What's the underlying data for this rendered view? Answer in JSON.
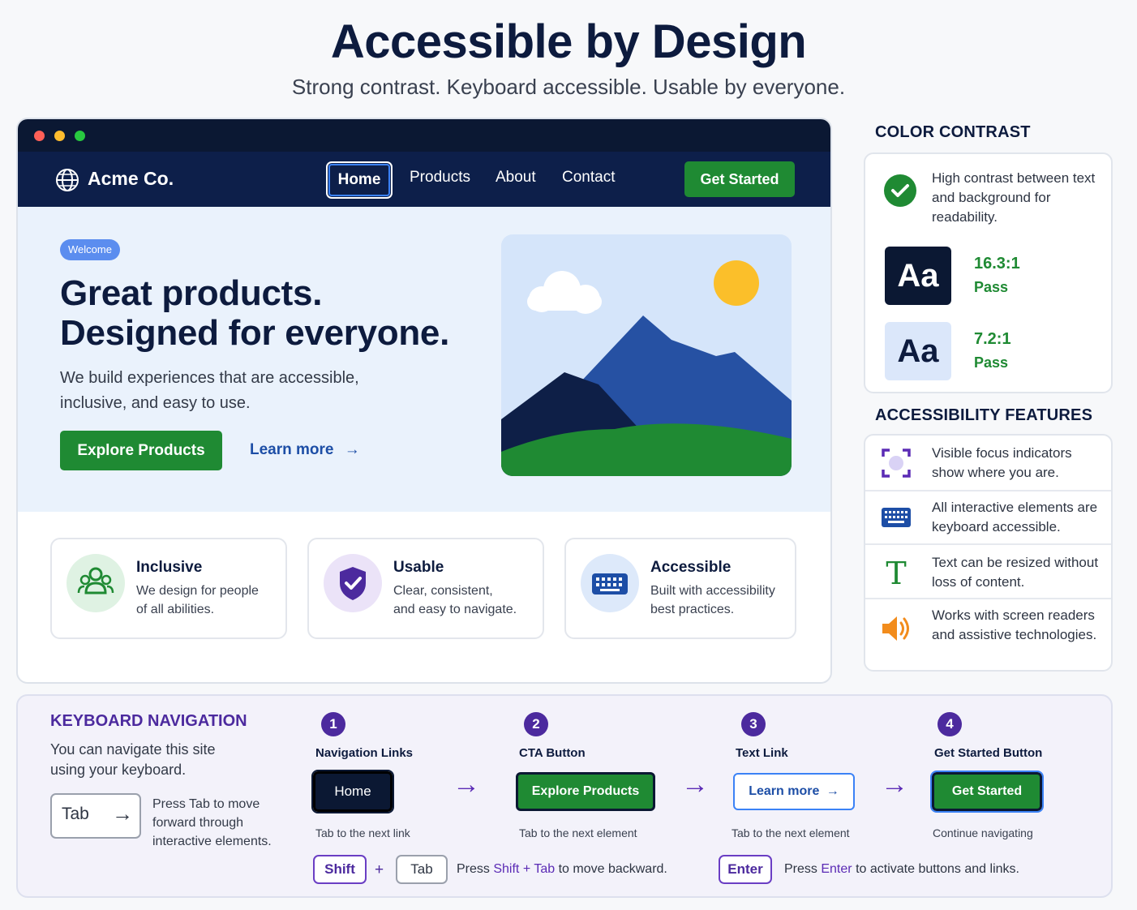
{
  "page": {
    "title": "Accessible by Design",
    "subtitle": "Strong contrast. Keyboard accessible. Usable by everyone."
  },
  "site": {
    "brand": "Acme Co.",
    "nav": [
      "Home",
      "Products",
      "About",
      "Contact"
    ],
    "cta": "Get Started",
    "hero": {
      "badge": "Welcome",
      "headline_1": "Great products.",
      "headline_2": "Designed for everyone.",
      "description": "We build experiences that are accessible, inclusive, and easy to use.",
      "primary_button": "Explore Products",
      "secondary_link": "Learn more"
    },
    "features": [
      {
        "title": "Inclusive",
        "desc_1": "We design for people",
        "desc_2": "of all abilities.",
        "icon": "people-icon",
        "color": "#1f8a33"
      },
      {
        "title": "Usable",
        "desc_1": "Clear, consistent,",
        "desc_2": "and easy to navigate.",
        "icon": "shield-check-icon",
        "color": "#4c2a9e"
      },
      {
        "title": "Accessible",
        "desc_1": "Built with accessibility",
        "desc_2": "best practices.",
        "icon": "keyboard-icon",
        "color": "#1d4ea6"
      }
    ]
  },
  "contrast": {
    "heading": "COLOR CONTRAST",
    "description": "High contrast between text and background for readability.",
    "samples": [
      {
        "text": "Aa",
        "ratio": "16.3:1",
        "result": "Pass",
        "bg": "#0b1833",
        "fg": "#ffffff"
      },
      {
        "text": "Aa",
        "ratio": "7.2:1",
        "result": "Pass",
        "bg": "#dbe7fa",
        "fg": "#0d1b3e"
      }
    ]
  },
  "features_panel": {
    "heading": "ACCESSIBILITY FEATURES",
    "items": [
      {
        "text": "Visible focus indicators show where you are.",
        "icon": "focus-frame-icon"
      },
      {
        "text": "All interactive elements are keyboard accessible.",
        "icon": "keyboard-icon"
      },
      {
        "text": "Text can be resized without loss of content.",
        "icon": "text-size-icon"
      },
      {
        "text": "Works with screen readers and assistive technologies.",
        "icon": "speaker-icon"
      }
    ]
  },
  "keyboard": {
    "heading": "KEYBOARD NAVIGATION",
    "description": "You can navigate this site using your keyboard.",
    "tab_key": "Tab",
    "tab_description": "Press Tab to move forward through interactive elements.",
    "steps": [
      {
        "num": "1",
        "label": "Navigation Links",
        "button": "Home",
        "caption": "Tab to the next link"
      },
      {
        "num": "2",
        "label": "CTA Button",
        "button": "Explore Products",
        "caption": "Tab to the next element"
      },
      {
        "num": "3",
        "label": "Text Link",
        "button": "Learn more",
        "caption": "Tab to the next element"
      },
      {
        "num": "4",
        "label": "Get Started Button",
        "button": "Get Started",
        "caption": "Continue navigating"
      }
    ],
    "shift_key": "Shift",
    "plus": "+",
    "tab_key_2": "Tab",
    "back_press": "Press",
    "back_combo": "Shift + Tab",
    "back_rest": "to move backward.",
    "enter_key": "Enter",
    "enter_press": "Press",
    "enter_word": "Enter",
    "enter_rest": "to activate buttons and links."
  },
  "colors": {
    "navy": "#0d1f4a",
    "green": "#1f8a33",
    "purple": "#4c2a9e",
    "blue": "#1d4ea6",
    "focus": "#3b82f6"
  }
}
